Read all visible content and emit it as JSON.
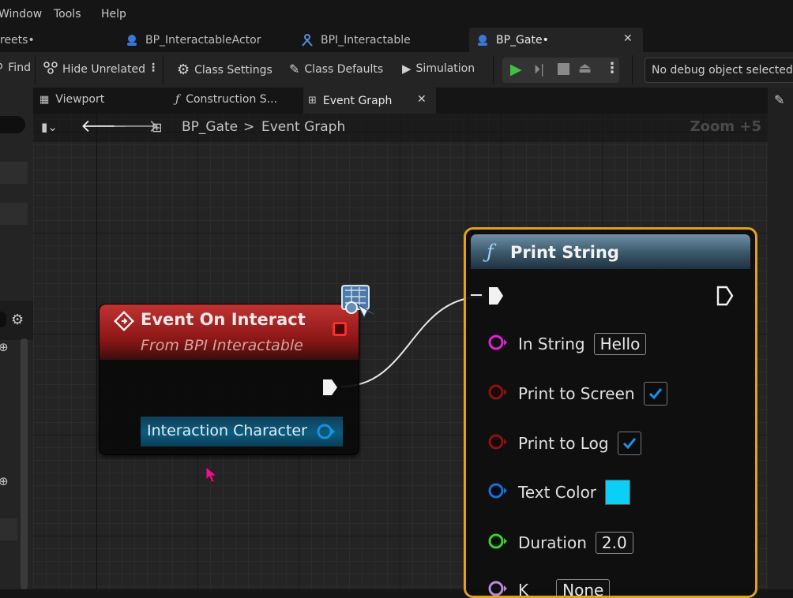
{
  "menu": {
    "items": [
      "Window",
      "Tools",
      "Help"
    ]
  },
  "tabs": [
    {
      "label": "reets•"
    },
    {
      "label": "BP_InteractableActor"
    },
    {
      "label": "BPI_Interactable"
    },
    {
      "label": "BP_Gate•"
    }
  ],
  "toolbar": {
    "find_label": "Find",
    "hide_unrelated_label": "Hide Unrelated",
    "class_settings_label": "Class Settings",
    "class_defaults_label": "Class Defaults",
    "simulation_label": "Simulation",
    "debug_select_value": "No debug object selected"
  },
  "subtabs": {
    "viewport": "Viewport",
    "construction": "Construction S...",
    "event_graph": "Event Graph"
  },
  "breadcrumb": {
    "root": "BP_Gate",
    "separator": ">",
    "current": "Event Graph",
    "zoom": "Zoom +5"
  },
  "event_node": {
    "title": "Event On Interact",
    "subtitle": "From BPI Interactable",
    "output_pin": "Interaction Character"
  },
  "print_node": {
    "title": "Print String",
    "in_string_label": "In String",
    "in_string_value": "Hello",
    "print_screen_label": "Print to Screen",
    "print_screen_checked": true,
    "print_log_label": "Print to Log",
    "print_log_checked": true,
    "text_color_label": "Text Color",
    "text_color_value": "#0ad0f8",
    "duration_label": "Duration",
    "duration_value": "2.0",
    "key_label": "K",
    "key_value": "None"
  },
  "colors": {
    "event_header": "#b02a28",
    "print_border": "#e1a219",
    "pin_string": "#e020d8",
    "pin_bool": "#8a1212",
    "pin_struct": "#1a6fd8",
    "pin_float": "#3ad12a",
    "pin_object": "#1a90e0"
  }
}
